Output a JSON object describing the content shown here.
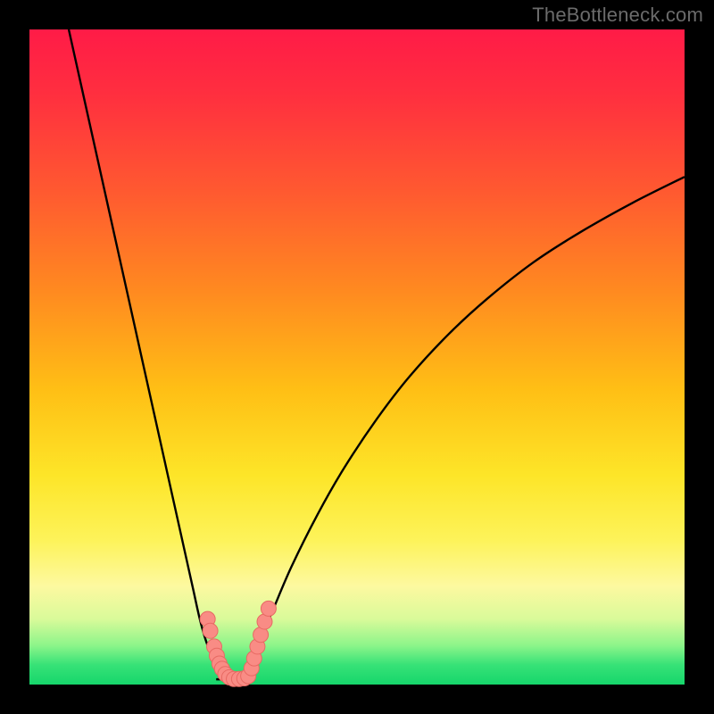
{
  "watermark": "TheBottleneck.com",
  "chart_data": {
    "type": "line",
    "title": "",
    "xlabel": "",
    "ylabel": "",
    "xlim": [
      0,
      100
    ],
    "ylim": [
      0,
      100
    ],
    "background_gradient": {
      "stops": [
        {
          "offset": 0.0,
          "color": "#ff1b47"
        },
        {
          "offset": 0.1,
          "color": "#ff2f3f"
        },
        {
          "offset": 0.25,
          "color": "#ff5a30"
        },
        {
          "offset": 0.4,
          "color": "#ff8a20"
        },
        {
          "offset": 0.55,
          "color": "#ffbf15"
        },
        {
          "offset": 0.68,
          "color": "#fde528"
        },
        {
          "offset": 0.78,
          "color": "#fdf35a"
        },
        {
          "offset": 0.85,
          "color": "#fdf9a0"
        },
        {
          "offset": 0.9,
          "color": "#d9fa9a"
        },
        {
          "offset": 0.94,
          "color": "#8df58a"
        },
        {
          "offset": 0.97,
          "color": "#37e277"
        },
        {
          "offset": 1.0,
          "color": "#16d66b"
        }
      ]
    },
    "series": [
      {
        "name": "curve-left",
        "x": [
          6,
          8,
          10,
          12,
          14,
          16,
          18,
          20,
          22,
          24,
          25,
          26,
          27,
          28,
          29,
          30
        ],
        "y": [
          100,
          91,
          82,
          73,
          64,
          55,
          46,
          37,
          28,
          19,
          14.5,
          10,
          6.5,
          4,
          2,
          1
        ]
      },
      {
        "name": "curve-right",
        "x": [
          32,
          33,
          34,
          35,
          37,
          40,
          44,
          48,
          53,
          58,
          64,
          70,
          77,
          84,
          92,
          100
        ],
        "y": [
          1,
          2,
          4,
          6.5,
          11,
          18,
          26,
          33,
          40.5,
          47,
          53.5,
          59,
          64.5,
          69,
          73.5,
          77.5
        ]
      }
    ],
    "flat_bottom": {
      "x": [
        28.5,
        33.5
      ],
      "y": 0.8
    },
    "markers": {
      "left_cluster": {
        "points": [
          [
            27.2,
            10.0
          ],
          [
            27.6,
            8.2
          ],
          [
            28.2,
            5.8
          ],
          [
            28.6,
            4.4
          ],
          [
            29.0,
            3.2
          ],
          [
            29.4,
            2.4
          ],
          [
            29.9,
            1.6
          ],
          [
            30.5,
            1.1
          ],
          [
            31.2,
            0.85
          ],
          [
            32.0,
            0.85
          ],
          [
            32.8,
            0.95
          ],
          [
            33.4,
            1.3
          ]
        ]
      },
      "right_cluster": {
        "points": [
          [
            33.9,
            2.5
          ],
          [
            34.3,
            4.0
          ],
          [
            34.8,
            5.8
          ],
          [
            35.3,
            7.6
          ],
          [
            35.9,
            9.6
          ],
          [
            36.5,
            11.6
          ]
        ]
      }
    },
    "colors": {
      "curve": "#000000",
      "marker_fill": "#f98c85",
      "marker_stroke": "#e76a63"
    }
  }
}
